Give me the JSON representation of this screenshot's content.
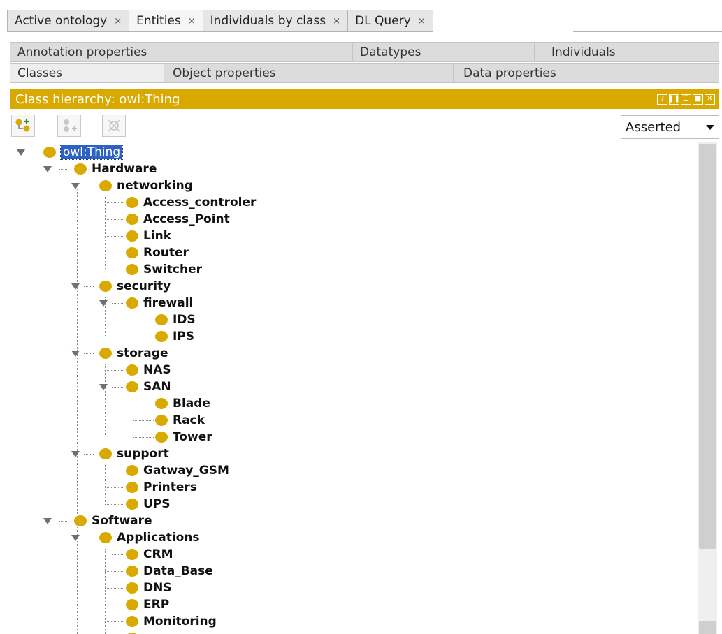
{
  "top_tabs": [
    {
      "label": "Active ontology",
      "close": "×"
    },
    {
      "label": "Entities",
      "close": "×"
    },
    {
      "label": "Individuals by class",
      "close": "×"
    },
    {
      "label": "DL Query",
      "close": "×"
    }
  ],
  "sub_tabs_row1": [
    "Annotation properties",
    "Datatypes",
    "Individuals"
  ],
  "sub_tabs_row2": [
    "Classes",
    "Object properties",
    "Data properties"
  ],
  "view": {
    "title": "Class hierarchy: owl:Thing",
    "controls": [
      "?",
      "❚❚",
      "☰",
      "■",
      "✕"
    ]
  },
  "toolbar": {
    "add_subclass_icon": "add-subclass-icon",
    "add_sibling_icon": "add-sibling-icon",
    "delete_icon": "delete-class-icon",
    "mode": "Asserted"
  },
  "tree": {
    "root": "owl:Thing",
    "hardware": "Hardware",
    "networking": "networking",
    "access_controler": "Access_controler",
    "access_point": "Access_Point",
    "link": "Link",
    "router": "Router",
    "switcher": "Switcher",
    "security": "security",
    "firewall": "firewall",
    "ids": "IDS",
    "ips": "IPS",
    "storage": "storage",
    "nas": "NAS",
    "san": "SAN",
    "blade": "Blade",
    "rack": "Rack",
    "tower": "Tower",
    "support": "support",
    "gatway_gsm": "Gatway_GSM",
    "printers": "Printers",
    "ups": "UPS",
    "software": "Software",
    "applications": "Applications",
    "crm": "CRM",
    "data_base": "Data_Base",
    "dns": "DNS",
    "erp": "ERP",
    "monitoring": "Monitoring"
  },
  "colors": {
    "accent": "#d9a900",
    "selection": "#2d62c4"
  }
}
